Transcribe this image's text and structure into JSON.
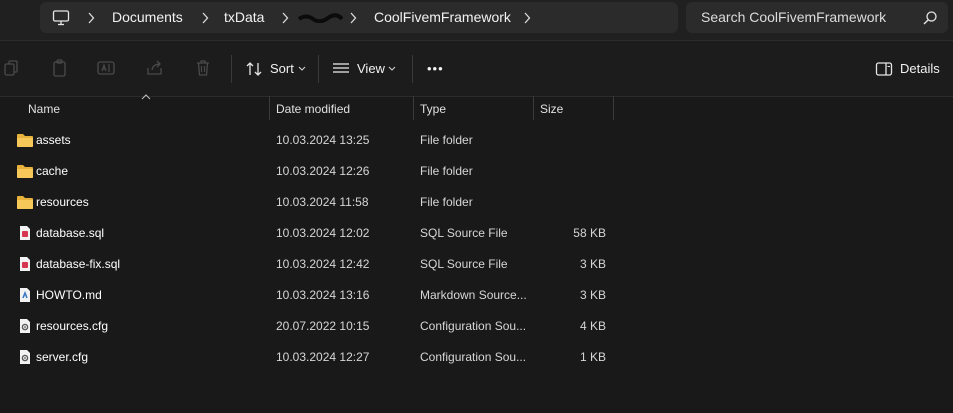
{
  "breadcrumb": {
    "items": [
      "Documents",
      "txData",
      "CoolFivemFramework"
    ]
  },
  "search": {
    "placeholder": "Search CoolFivemFramework"
  },
  "toolbar": {
    "sort_label": "Sort",
    "view_label": "View",
    "more_label": "•••",
    "details_label": "Details"
  },
  "columns": {
    "name": "Name",
    "date": "Date modified",
    "type": "Type",
    "size": "Size"
  },
  "files": [
    {
      "name": "assets",
      "date": "10.03.2024 13:25",
      "type": "File folder",
      "size": "",
      "icon": "folder-icon"
    },
    {
      "name": "cache",
      "date": "10.03.2024 12:26",
      "type": "File folder",
      "size": "",
      "icon": "folder-icon"
    },
    {
      "name": "resources",
      "date": "10.03.2024 11:58",
      "type": "File folder",
      "size": "",
      "icon": "folder-icon"
    },
    {
      "name": "database.sql",
      "date": "10.03.2024 12:02",
      "type": "SQL Source File",
      "size": "58 KB",
      "icon": "sql-file-icon"
    },
    {
      "name": "database-fix.sql",
      "date": "10.03.2024 12:42",
      "type": "SQL Source File",
      "size": "3 KB",
      "icon": "sql-file-icon"
    },
    {
      "name": "HOWTO.md",
      "date": "10.03.2024 13:16",
      "type": "Markdown Source...",
      "size": "3 KB",
      "icon": "markdown-file-icon"
    },
    {
      "name": "resources.cfg",
      "date": "20.07.2022 10:15",
      "type": "Configuration Sou...",
      "size": "4 KB",
      "icon": "config-file-icon"
    },
    {
      "name": "server.cfg",
      "date": "10.03.2024 12:27",
      "type": "Configuration Sou...",
      "size": "1 KB",
      "icon": "config-file-icon"
    }
  ]
}
